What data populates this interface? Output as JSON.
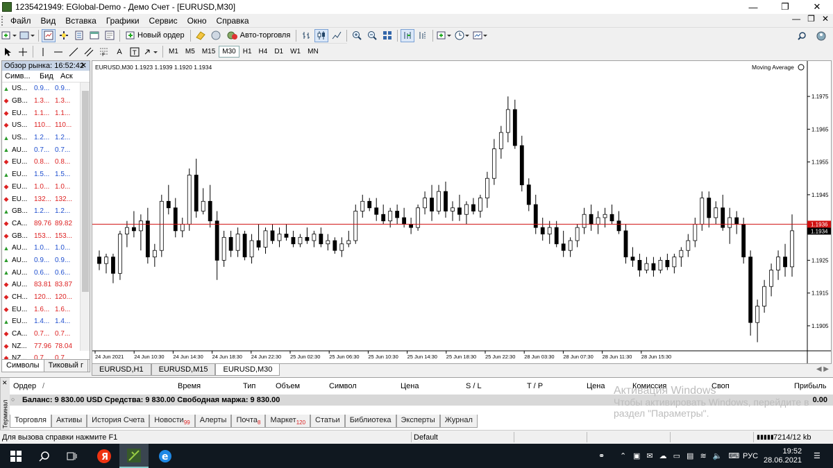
{
  "window": {
    "title": "1235421949: EGlobal-Demo - Демо Счет - [EURUSD,M30]"
  },
  "menu": [
    "Файл",
    "Вид",
    "Вставка",
    "Графики",
    "Сервис",
    "Окно",
    "Справка"
  ],
  "toolbar": {
    "new_order_label": "Новый ордер",
    "auto_trading_label": "Авто-торговля",
    "timeframes": [
      "M1",
      "M5",
      "M15",
      "M30",
      "H1",
      "H4",
      "D1",
      "W1",
      "MN"
    ],
    "active_timeframe": "M30",
    "icons": [
      "new-chart-icon",
      "profiles-icon",
      "market-watch-icon",
      "navigator-icon",
      "data-window-icon",
      "terminal-icon",
      "tester-icon",
      "new-order-icon",
      "metaeditor-icon",
      "auto-trading-icon",
      "bar-chart-icon",
      "candles-icon",
      "line-chart-icon",
      "zoom-in-icon",
      "zoom-out-icon",
      "tile-icon",
      "autoscroll-icon",
      "chart-shift-icon",
      "indicators-icon",
      "periods-icon",
      "templates-icon",
      "search-icon",
      "user-icon"
    ],
    "draw_tools": [
      "cursor-icon",
      "crosshair-icon",
      "vertical-line-icon",
      "horizontal-line-icon",
      "trend-line-icon",
      "equidistant-channel-icon",
      "fibonacci-icon",
      "text-icon",
      "text-label-icon",
      "arrows-icon"
    ]
  },
  "market_watch": {
    "title": "Обзор рынка: 16:52:42",
    "headers": [
      "Симв...",
      "Бид",
      "Аск"
    ],
    "rows": [
      {
        "dir": "up",
        "symbol": "US...",
        "bid": "0.9...",
        "ask": "0.9...",
        "color": "up"
      },
      {
        "dir": "down",
        "symbol": "GB...",
        "bid": "1.3...",
        "ask": "1.3...",
        "color": "down"
      },
      {
        "dir": "down",
        "symbol": "EU...",
        "bid": "1.1...",
        "ask": "1.1...",
        "color": "down"
      },
      {
        "dir": "down",
        "symbol": "US...",
        "bid": "110...",
        "ask": "110...",
        "color": "down"
      },
      {
        "dir": "up",
        "symbol": "US...",
        "bid": "1.2...",
        "ask": "1.2...",
        "color": "up"
      },
      {
        "dir": "up",
        "symbol": "AU...",
        "bid": "0.7...",
        "ask": "0.7...",
        "color": "up"
      },
      {
        "dir": "down",
        "symbol": "EU...",
        "bid": "0.8...",
        "ask": "0.8...",
        "color": "down"
      },
      {
        "dir": "up",
        "symbol": "EU...",
        "bid": "1.5...",
        "ask": "1.5...",
        "color": "up"
      },
      {
        "dir": "down",
        "symbol": "EU...",
        "bid": "1.0...",
        "ask": "1.0...",
        "color": "down"
      },
      {
        "dir": "down",
        "symbol": "EU...",
        "bid": "132...",
        "ask": "132...",
        "color": "down"
      },
      {
        "dir": "up",
        "symbol": "GB...",
        "bid": "1.2...",
        "ask": "1.2...",
        "color": "up"
      },
      {
        "dir": "down",
        "symbol": "CA...",
        "bid": "89.76",
        "ask": "89.82",
        "color": "down"
      },
      {
        "dir": "down",
        "symbol": "GB...",
        "bid": "153...",
        "ask": "153...",
        "color": "down"
      },
      {
        "dir": "up",
        "symbol": "AU...",
        "bid": "1.0...",
        "ask": "1.0...",
        "color": "up"
      },
      {
        "dir": "up",
        "symbol": "AU...",
        "bid": "0.9...",
        "ask": "0.9...",
        "color": "up"
      },
      {
        "dir": "up",
        "symbol": "AU...",
        "bid": "0.6...",
        "ask": "0.6...",
        "color": "up"
      },
      {
        "dir": "down",
        "symbol": "AU...",
        "bid": "83.81",
        "ask": "83.87",
        "color": "down"
      },
      {
        "dir": "down",
        "symbol": "CH...",
        "bid": "120...",
        "ask": "120...",
        "color": "down"
      },
      {
        "dir": "down",
        "symbol": "EU...",
        "bid": "1.6...",
        "ask": "1.6...",
        "color": "down"
      },
      {
        "dir": "up",
        "symbol": "EU...",
        "bid": "1.4...",
        "ask": "1.4...",
        "color": "up"
      },
      {
        "dir": "down",
        "symbol": "CA...",
        "bid": "0.7...",
        "ask": "0.7...",
        "color": "down"
      },
      {
        "dir": "down",
        "symbol": "NZ...",
        "bid": "77.96",
        "ask": "78.04",
        "color": "down"
      },
      {
        "dir": "down",
        "symbol": "NZ...",
        "bid": "0.7...",
        "ask": "0.7...",
        "color": "down"
      }
    ],
    "tabs": [
      "Символы",
      "Тиковый г"
    ]
  },
  "chart": {
    "header": "EURUSD,M30  1.1923 1.1939 1.1920 1.1934",
    "indicator": "Moving Average",
    "current_price": "1.1936",
    "last_price": "1.1934",
    "tabs": [
      "EURUSD,H1",
      "EURUSD,M15",
      "EURUSD,M30"
    ],
    "active_tab": "EURUSD,M30"
  },
  "chart_data": {
    "type": "candlestick",
    "symbol": "EURUSD",
    "timeframe": "M30",
    "ylim": [
      1.1898,
      1.1982
    ],
    "y_ticks": [
      "1.1975",
      "1.1965",
      "1.1955",
      "1.1945",
      "1.1935",
      "1.1925",
      "1.1915",
      "1.1905"
    ],
    "x_ticks": [
      "24 Jun 2021",
      "24 Jun 10:30",
      "24 Jun 14:30",
      "24 Jun 18:30",
      "24 Jun 22:30",
      "25 Jun 02:30",
      "25 Jun 06:30",
      "25 Jun 10:30",
      "25 Jun 14:30",
      "25 Jun 18:30",
      "25 Jun 22:30",
      "28 Jun 03:30",
      "28 Jun 07:30",
      "28 Jun 11:30",
      "28 Jun 15:30"
    ],
    "current_price": 1.1936,
    "candles": [
      [
        1.1926,
        1.1928,
        1.1922,
        1.1924
      ],
      [
        1.1924,
        1.1927,
        1.1921,
        1.1926
      ],
      [
        1.1926,
        1.1927,
        1.1918,
        1.1921
      ],
      [
        1.1921,
        1.1934,
        1.1919,
        1.1933
      ],
      [
        1.1933,
        1.1937,
        1.1929,
        1.1935
      ],
      [
        1.1935,
        1.194,
        1.1932,
        1.1934
      ],
      [
        1.1934,
        1.1939,
        1.1928,
        1.1937
      ],
      [
        1.1937,
        1.1941,
        1.1924,
        1.1926
      ],
      [
        1.1926,
        1.193,
        1.1923,
        1.1928
      ],
      [
        1.1928,
        1.1945,
        1.1926,
        1.1943
      ],
      [
        1.1943,
        1.1948,
        1.1939,
        1.1941
      ],
      [
        1.1941,
        1.1944,
        1.1932,
        1.1934
      ],
      [
        1.1934,
        1.1938,
        1.1932,
        1.1936
      ],
      [
        1.1936,
        1.1953,
        1.1934,
        1.1951
      ],
      [
        1.1951,
        1.1956,
        1.1938,
        1.194
      ],
      [
        1.194,
        1.1947,
        1.1939,
        1.1943
      ],
      [
        1.1943,
        1.1948,
        1.1935,
        1.1937
      ],
      [
        1.1937,
        1.194,
        1.1919,
        1.1925
      ],
      [
        1.1925,
        1.1934,
        1.1923,
        1.1932
      ],
      [
        1.1932,
        1.1934,
        1.1926,
        1.1928
      ],
      [
        1.1928,
        1.1935,
        1.1926,
        1.1933
      ],
      [
        1.1933,
        1.1934,
        1.1925,
        1.1926
      ],
      [
        1.1926,
        1.1933,
        1.1924,
        1.1931
      ],
      [
        1.1931,
        1.1936,
        1.1928,
        1.1929
      ],
      [
        1.1929,
        1.1935,
        1.1927,
        1.1934
      ],
      [
        1.1934,
        1.1936,
        1.193,
        1.1931
      ],
      [
        1.1931,
        1.1935,
        1.1929,
        1.1933
      ],
      [
        1.1933,
        1.1936,
        1.1931,
        1.1932
      ],
      [
        1.1932,
        1.1934,
        1.1929,
        1.193
      ],
      [
        1.193,
        1.1933,
        1.1929,
        1.1932
      ],
      [
        1.1932,
        1.1935,
        1.193,
        1.1931
      ],
      [
        1.1931,
        1.1934,
        1.1929,
        1.1933
      ],
      [
        1.1933,
        1.1935,
        1.1929,
        1.193
      ],
      [
        1.193,
        1.1933,
        1.1928,
        1.1931
      ],
      [
        1.1931,
        1.1932,
        1.1927,
        1.1928
      ],
      [
        1.1928,
        1.1932,
        1.1926,
        1.193
      ],
      [
        1.193,
        1.1934,
        1.1929,
        1.1931
      ],
      [
        1.1931,
        1.1942,
        1.193,
        1.194
      ],
      [
        1.194,
        1.1945,
        1.1938,
        1.1943
      ],
      [
        1.1943,
        1.1944,
        1.194,
        1.1941
      ],
      [
        1.1941,
        1.1944,
        1.1937,
        1.1939
      ],
      [
        1.1939,
        1.1942,
        1.1936,
        1.1937
      ],
      [
        1.1937,
        1.1941,
        1.1935,
        1.194
      ],
      [
        1.194,
        1.1942,
        1.1936,
        1.1938
      ],
      [
        1.1938,
        1.1941,
        1.1935,
        1.1936
      ],
      [
        1.1936,
        1.1938,
        1.1933,
        1.1935
      ],
      [
        1.1935,
        1.1942,
        1.1934,
        1.1941
      ],
      [
        1.1941,
        1.1946,
        1.1939,
        1.1944
      ],
      [
        1.1944,
        1.1948,
        1.1937,
        1.194
      ],
      [
        1.194,
        1.1948,
        1.1939,
        1.1946
      ],
      [
        1.1946,
        1.1949,
        1.1938,
        1.194
      ],
      [
        1.194,
        1.1943,
        1.1937,
        1.1941
      ],
      [
        1.1941,
        1.1945,
        1.1937,
        1.1939
      ],
      [
        1.1939,
        1.1943,
        1.1936,
        1.1942
      ],
      [
        1.1942,
        1.1944,
        1.1939,
        1.194
      ],
      [
        1.194,
        1.1945,
        1.1938,
        1.1944
      ],
      [
        1.1944,
        1.1952,
        1.1941,
        1.195
      ],
      [
        1.195,
        1.1962,
        1.1948,
        1.1959
      ],
      [
        1.1959,
        1.1966,
        1.1956,
        1.1964
      ],
      [
        1.1964,
        1.1975,
        1.1961,
        1.1971
      ],
      [
        1.1971,
        1.1974,
        1.1959,
        1.196
      ],
      [
        1.196,
        1.1963,
        1.1946,
        1.1948
      ],
      [
        1.1948,
        1.195,
        1.194,
        1.1942
      ],
      [
        1.1942,
        1.1945,
        1.1933,
        1.1935
      ],
      [
        1.1935,
        1.1938,
        1.1931,
        1.1933
      ],
      [
        1.1933,
        1.1937,
        1.193,
        1.1935
      ],
      [
        1.1935,
        1.1937,
        1.1929,
        1.193
      ],
      [
        1.193,
        1.1934,
        1.1926,
        1.1928
      ],
      [
        1.1928,
        1.1932,
        1.1926,
        1.1931
      ],
      [
        1.1931,
        1.1936,
        1.1929,
        1.1935
      ],
      [
        1.1935,
        1.1941,
        1.1933,
        1.1939
      ],
      [
        1.1939,
        1.1942,
        1.1934,
        1.1936
      ],
      [
        1.1936,
        1.194,
        1.1933,
        1.1938
      ],
      [
        1.1938,
        1.1941,
        1.1935,
        1.1939
      ],
      [
        1.1939,
        1.1942,
        1.1936,
        1.1937
      ],
      [
        1.1937,
        1.194,
        1.1933,
        1.1934
      ],
      [
        1.1934,
        1.1936,
        1.1924,
        1.1926
      ],
      [
        1.1926,
        1.1929,
        1.1923,
        1.1925
      ],
      [
        1.1925,
        1.1927,
        1.192,
        1.1922
      ],
      [
        1.1922,
        1.1926,
        1.1921,
        1.1924
      ],
      [
        1.1924,
        1.1926,
        1.192,
        1.1922
      ],
      [
        1.1922,
        1.1926,
        1.1921,
        1.1925
      ],
      [
        1.1925,
        1.1927,
        1.1922,
        1.1923
      ],
      [
        1.1923,
        1.1927,
        1.1921,
        1.1926
      ],
      [
        1.1926,
        1.1929,
        1.1923,
        1.1928
      ],
      [
        1.1928,
        1.1933,
        1.1926,
        1.1931
      ],
      [
        1.1931,
        1.1938,
        1.1929,
        1.1936
      ],
      [
        1.1936,
        1.1946,
        1.1934,
        1.1944
      ],
      [
        1.1944,
        1.1946,
        1.1935,
        1.1938
      ],
      [
        1.1938,
        1.1943,
        1.1936,
        1.1941
      ],
      [
        1.1941,
        1.1945,
        1.1934,
        1.1935
      ],
      [
        1.1935,
        1.1941,
        1.193,
        1.1938
      ],
      [
        1.1938,
        1.194,
        1.1933,
        1.1936
      ],
      [
        1.1936,
        1.1938,
        1.1924,
        1.1926
      ],
      [
        1.1926,
        1.1928,
        1.1902,
        1.1906
      ],
      [
        1.1906,
        1.1913,
        1.19,
        1.1911
      ],
      [
        1.1911,
        1.1919,
        1.1909,
        1.1917
      ],
      [
        1.1917,
        1.1924,
        1.1914,
        1.1922
      ],
      [
        1.1922,
        1.1928,
        1.1919,
        1.1926
      ],
      [
        1.1926,
        1.193,
        1.192,
        1.1923
      ],
      [
        1.1923,
        1.1939,
        1.192,
        1.1934
      ]
    ]
  },
  "terminal": {
    "side_label": "Терминал",
    "headers": [
      "Ордер",
      "/",
      "Время",
      "Тип",
      "Объем",
      "Символ",
      "Цена",
      "S / L",
      "T / P",
      "Цена",
      "Комиссия",
      "Своп",
      "Прибыль"
    ],
    "balance_text": "Баланс: 9 830.00 USD  Средства: 9 830.00  Свободная маржа: 9 830.00",
    "profit": "0.00",
    "tabs": [
      {
        "label": "Торговля",
        "badge": ""
      },
      {
        "label": "Активы",
        "badge": ""
      },
      {
        "label": "История Счета",
        "badge": ""
      },
      {
        "label": "Новости",
        "badge": "99"
      },
      {
        "label": "Алерты",
        "badge": ""
      },
      {
        "label": "Почта",
        "badge": "8"
      },
      {
        "label": "Маркет",
        "badge": "120"
      },
      {
        "label": "Статьи",
        "badge": ""
      },
      {
        "label": "Библиотека",
        "badge": ""
      },
      {
        "label": "Эксперты",
        "badge": ""
      },
      {
        "label": "Журнал",
        "badge": ""
      }
    ]
  },
  "activation_watermark": {
    "line1": "Активация Windows",
    "line2": "Чтобы активировать Windows, перейдите в",
    "line3": "раздел \"Параметры\"."
  },
  "status": {
    "help": "Для вызова справки нажмите F1",
    "profile": "Default",
    "connection": "7214/12 kb"
  },
  "taskbar": {
    "lang": "РУС",
    "time": "19:52",
    "date": "28.06.2021"
  },
  "colors": {
    "price_line": "#d01010",
    "bull": "#ffffff",
    "bear": "#000000",
    "up_text": "#1f4fcf",
    "down_text": "#d22222"
  }
}
